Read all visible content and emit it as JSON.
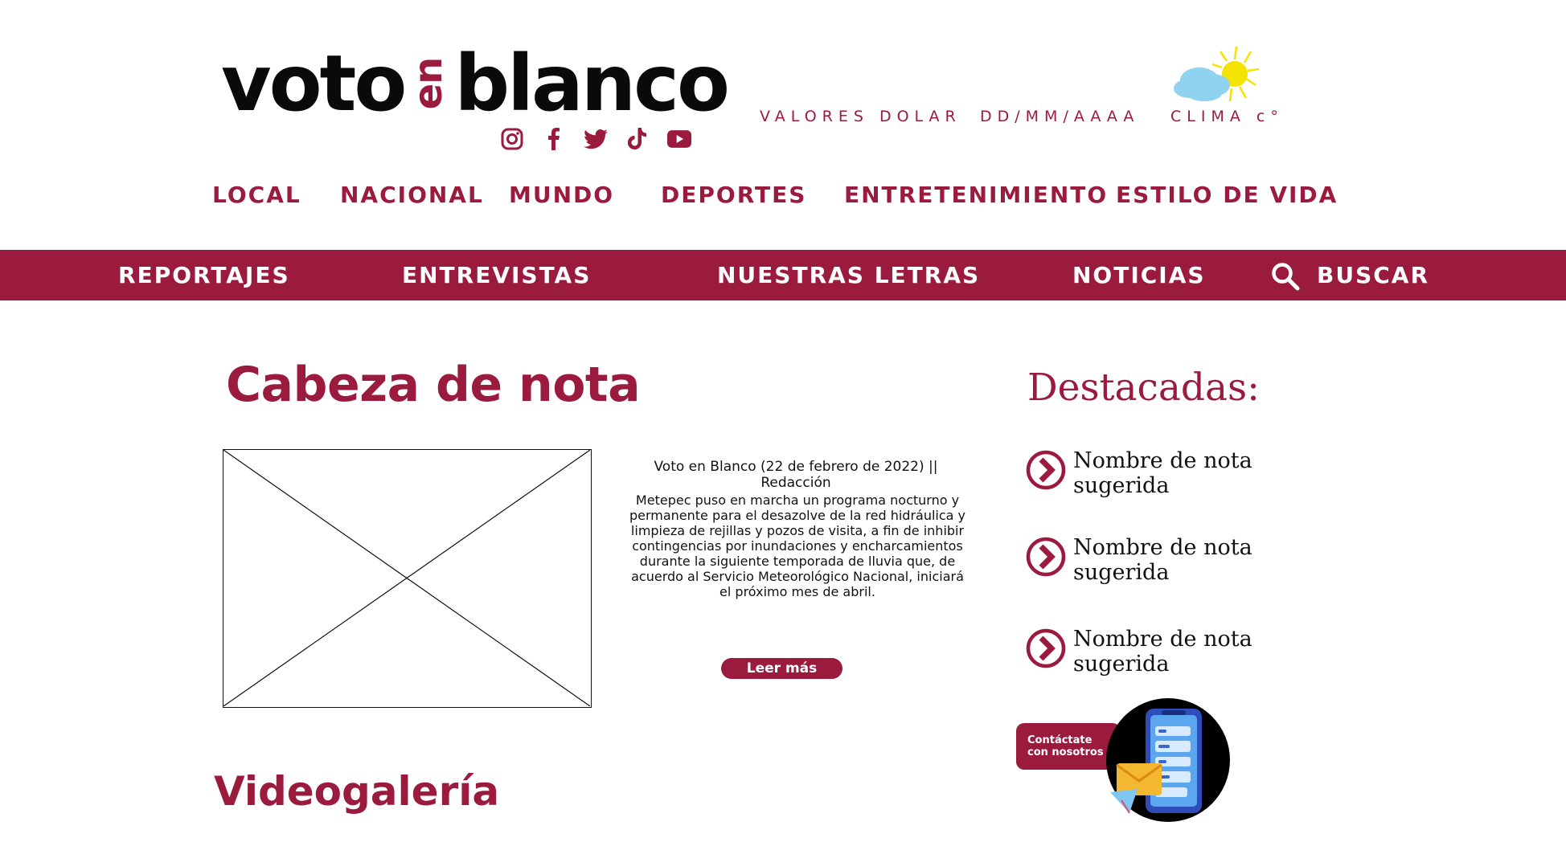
{
  "logo": {
    "part1": "voto",
    "en": "en",
    "part2": "blanco"
  },
  "social": [
    "instagram-icon",
    "facebook-icon",
    "twitter-icon",
    "tiktok-icon",
    "youtube-icon"
  ],
  "top_info": {
    "dolar": "VALORES DOLAR",
    "fecha": "DD/MM/AAAA",
    "clima": "CLIMA c°"
  },
  "nav_primary": [
    "LOCAL",
    "NACIONAL",
    "MUNDO",
    "DEPORTES",
    "ENTRETENIMIENTO",
    "ESTILO DE VIDA"
  ],
  "nav_secondary": [
    "REPORTAJES",
    "ENTREVISTAS",
    "NUESTRAS LETRAS",
    "NOTICIAS"
  ],
  "search_label": "BUSCAR",
  "article": {
    "headline": "Cabeza de nota",
    "byline": "Voto en Blanco (22 de febrero de 2022) || Redacción",
    "body": "Metepec puso en marcha un programa nocturno y permanente para el desazolve de la red hidráulica y limpieza de rejillas y pozos de visita, a fin de inhibir contingencias por inundaciones y encharcamientos durante la siguiente temporada de lluvia que, de acuerdo al Servicio Meteorológico Nacional, iniciará el próximo mes de abril.",
    "read_more": "Leer más"
  },
  "videogaleria": "Videogalería",
  "destacadas": {
    "title": "Destacadas:",
    "items": [
      "Nombre de nota sugerida",
      "Nombre de nota sugerida",
      "Nombre de nota sugerida"
    ]
  },
  "contact": {
    "label": "Contáctate con nosotros"
  },
  "colors": {
    "brand": "#9b1b3f",
    "text": "#111111",
    "background": "#ffffff"
  }
}
